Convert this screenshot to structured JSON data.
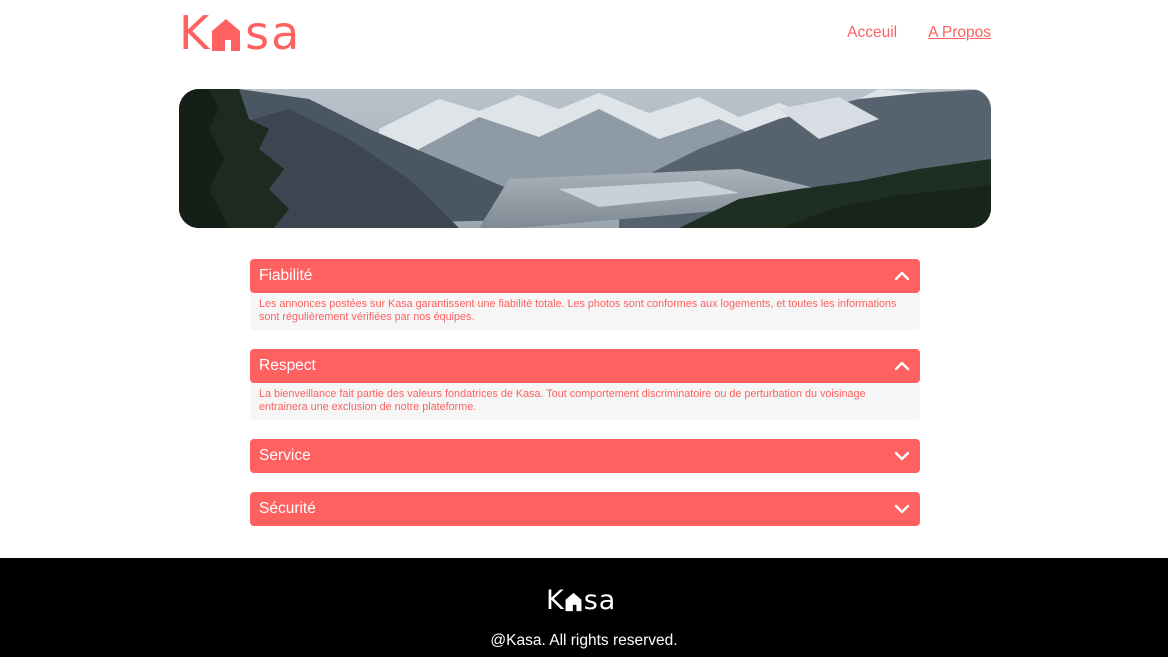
{
  "header": {
    "logo": {
      "first_letter": "K",
      "rest": "sa",
      "house_icon": "house-icon",
      "color": "#FF6060"
    },
    "nav": [
      {
        "label": "Acceuil",
        "active": false
      },
      {
        "label": "A Propos",
        "active": true
      }
    ]
  },
  "banner": {
    "icon": "mountain-landscape-image"
  },
  "collapses": [
    {
      "title": "Fiabilité",
      "open": true,
      "icon": "chevron-up-icon",
      "content": "Les annonces postées sur Kasa garantissent une fiabilité totale. Les photos sont conformes aux logements, et toutes les informations sont régulièrement vérifiées par nos équipes."
    },
    {
      "title": "Respect",
      "open": true,
      "icon": "chevron-up-icon",
      "content": "La bienveillance fait partie des valeurs fondatrices de Kasa. Tout comportement discriminatoire ou de perturbation du voisinage entrainera une exclusion de notre plateforme."
    },
    {
      "title": "Service",
      "open": false,
      "icon": "chevron-down-icon"
    },
    {
      "title": "Sécurité",
      "open": false,
      "icon": "chevron-down-icon"
    }
  ],
  "footer": {
    "logo": {
      "first_letter": "K",
      "rest": "sa",
      "house_icon": "house-icon"
    },
    "copyright": "@Kasa. All rights reserved."
  },
  "colors": {
    "accent": "#FF6060",
    "panel": "#F6F6F6",
    "footer_bg": "#000000"
  }
}
